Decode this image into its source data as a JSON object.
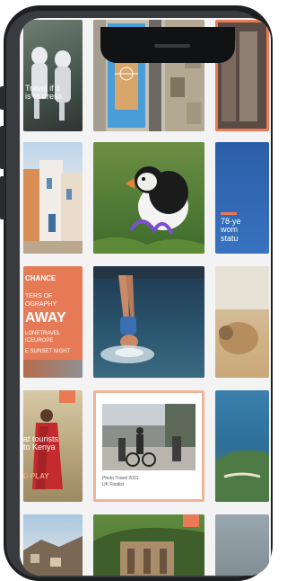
{
  "colors": {
    "accent": "#e97a54",
    "frame": "#1e1f22",
    "screen_bg": "#f3f3f3"
  },
  "feed": {
    "tile_astronauts": {
      "caption_lines": [
        "Travel if it",
        "is to dress"
      ]
    },
    "tile_basketball": {},
    "tile_street": {},
    "tile_village": {},
    "tile_puffin": {},
    "tile_statue": {
      "caption_lines": [
        "78-ye",
        "wom",
        "statu"
      ]
    },
    "tile_poster": {
      "title_lines": [
        "CHANCE",
        "TERS OF",
        "OGRAPHY",
        "AWAY"
      ],
      "sub_lines": [
        "LONETRAVEL",
        "ICEUROPE",
        "E SUNSET NIGHT"
      ]
    },
    "tile_diver": {},
    "tile_sheep": {},
    "tile_kenya": {
      "caption_lines": [
        "at tourists",
        "to Kenya"
      ],
      "cta": "D PLAY"
    },
    "tile_cyclists": {
      "caption_lines": [
        "Photo Travel 2021",
        "UK Finalist"
      ]
    },
    "tile_coast": {},
    "tile_town": {},
    "tile_ruins": {},
    "tile_edge_bottom": {}
  }
}
